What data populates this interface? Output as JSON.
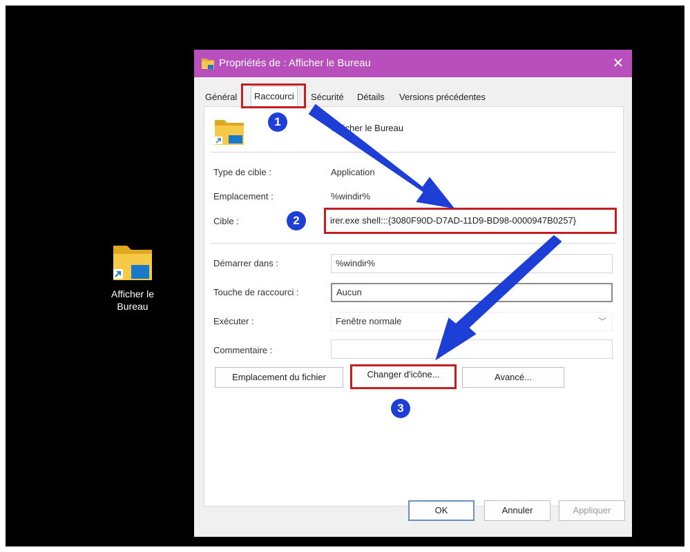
{
  "desktop": {
    "icon_label_line1": "Afficher le",
    "icon_label_line2": "Bureau",
    "icon": "folder-shortcut-icon"
  },
  "dialog": {
    "title": "Propriétés de : Afficher le Bureau",
    "title_icon": "folder-icon",
    "close": "✕",
    "tabs": [
      "Général",
      "Raccourci",
      "Sécurité",
      "Détails",
      "Versions précédentes"
    ],
    "active_tab": "Raccourci",
    "shortcut_name": "Afficher le Bureau",
    "fields": {
      "type_label": "Type de cible :",
      "type_value": "Application",
      "location_label": "Emplacement :",
      "location_value": "%windir%",
      "target_label": "Cible :",
      "target_value": "irer.exe shell:::{3080F90D-D7AD-11D9-BD98-0000947B0257}",
      "start_label": "Démarrer dans :",
      "start_value": "%windir%",
      "hotkey_label": "Touche de raccourci :",
      "hotkey_value": "Aucun",
      "run_label": "Exécuter :",
      "run_value": "Fenêtre normale",
      "comment_label": "Commentaire :",
      "comment_value": ""
    },
    "buttons": {
      "open_location": "Emplacement du fichier",
      "change_icon": "Changer d'icône...",
      "advanced": "Avancé...",
      "ok": "OK",
      "cancel": "Annuler",
      "apply": "Appliquer"
    }
  },
  "annotations": {
    "badge1": "1",
    "badge2": "2",
    "badge3": "3",
    "highlight_color": "#c41d23",
    "arrow_color": "#1d3fd6"
  }
}
